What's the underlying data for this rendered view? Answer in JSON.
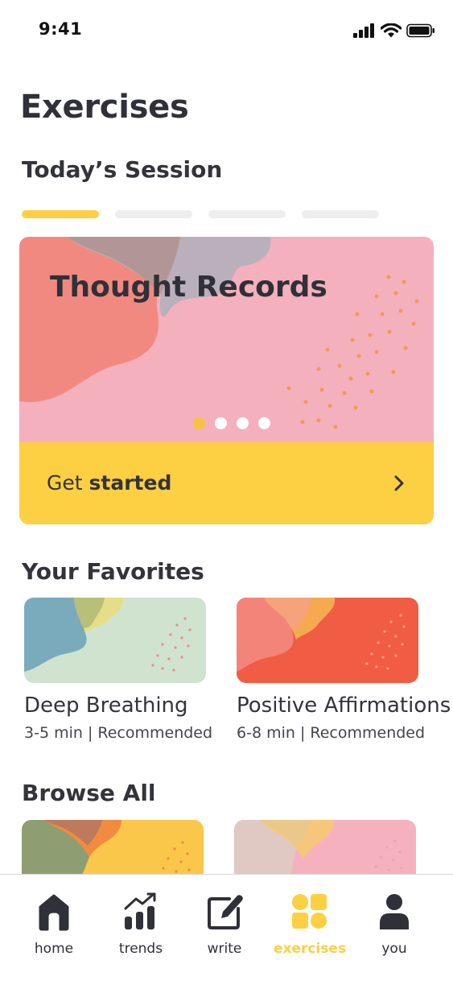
{
  "status_bar": {
    "time": "9:41"
  },
  "header": {
    "title": "Exercises"
  },
  "session": {
    "title": "Today’s Session",
    "progress_total": 4,
    "progress_current": 1,
    "card": {
      "title": "Thought Records",
      "cta_prefix": "Get ",
      "cta_bold": "started",
      "pages": 4,
      "current_page": 1
    }
  },
  "favorites": {
    "title": "Your Favorites",
    "items": [
      {
        "name": "Deep Breathing",
        "meta": "3-5 min | Recommended"
      },
      {
        "name": "Positive Affirmations",
        "meta": "6-8 min | Recommended"
      }
    ]
  },
  "browse": {
    "title": "Browse All"
  },
  "tabs": [
    {
      "label": "home",
      "icon": "home-icon",
      "active": false
    },
    {
      "label": "trends",
      "icon": "trends-icon",
      "active": false
    },
    {
      "label": "write",
      "icon": "write-icon",
      "active": false
    },
    {
      "label": "exercises",
      "icon": "exercises-icon",
      "active": true
    },
    {
      "label": "you",
      "icon": "profile-icon",
      "active": false
    }
  ],
  "colors": {
    "accent_yellow": "#fdcf42",
    "hero_pink": "#f4b0bc",
    "coral": "#f07d78",
    "text_dark": "#33333b",
    "tab_inactive": "#2f3038"
  }
}
